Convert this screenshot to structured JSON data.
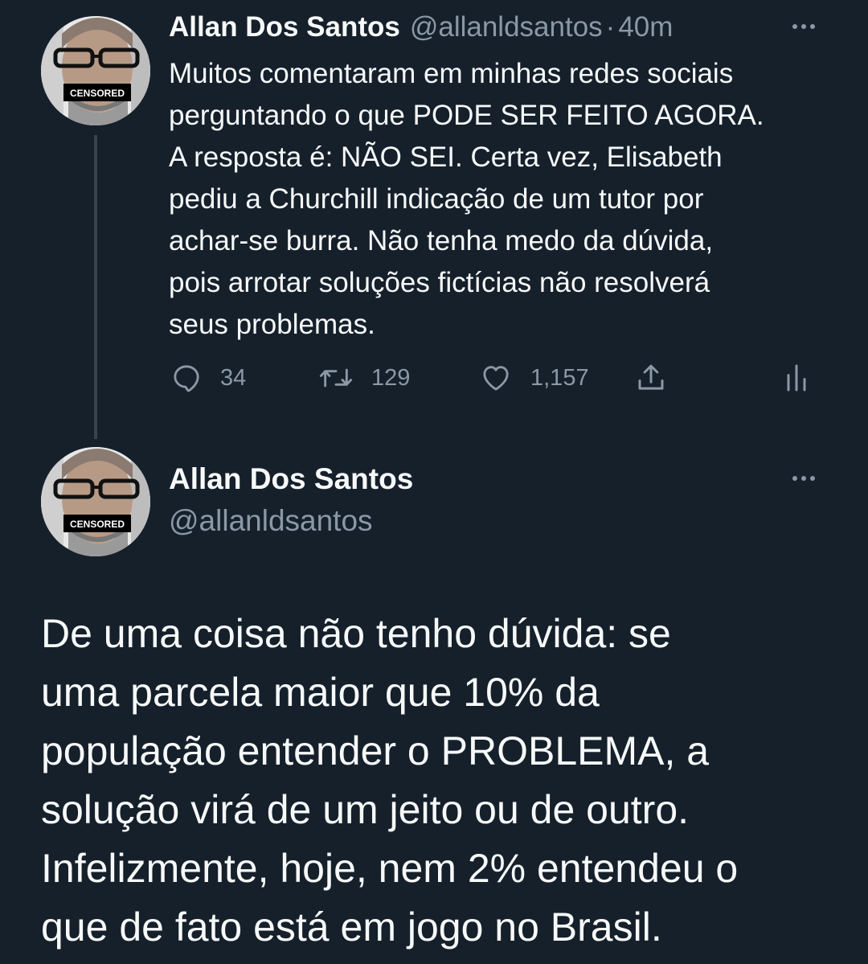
{
  "thread": {
    "first_tweet": {
      "author_name": "Allan Dos Santos",
      "author_handle": "@allanldsantos",
      "separator": "·",
      "time": "40m",
      "avatar_badge": "CENSORED",
      "text": "Muitos comentaram em minhas redes sociais\nperguntando o que PODE SER FEITO AGORA.\nA resposta é: NÃO SEI. Certa vez, Elisabeth\npediu a Churchill indicação de um tutor por\nachar-se burra. Não tenha medo da dúvida,\npois arrotar soluções fictícias não resolverá\nseus problemas.",
      "actions": {
        "reply_count": "34",
        "retweet_count": "129",
        "like_count": "1,157"
      }
    },
    "second_tweet": {
      "author_name": "Allan Dos Santos",
      "author_handle": "@allanldsantos",
      "avatar_badge": "CENSORED",
      "text": "De uma coisa não tenho dúvida: se\numa parcela maior que 10% da\npopulação entender o PROBLEMA, a\nsolução virá de um jeito ou de outro.\nInfelizmente, hoje, nem 2% entendeu o\nque de fato está em jogo no Brasil."
    }
  },
  "icons": {
    "reply": "reply-icon",
    "retweet": "retweet-icon",
    "like": "heart-icon",
    "share": "share-icon",
    "analytics": "analytics-icon",
    "more": "more-options-icon"
  },
  "colors": {
    "background": "#15202b",
    "primary_text": "#f7f9f9",
    "secondary_text": "#8b98a5",
    "thread_line": "#38444d"
  }
}
